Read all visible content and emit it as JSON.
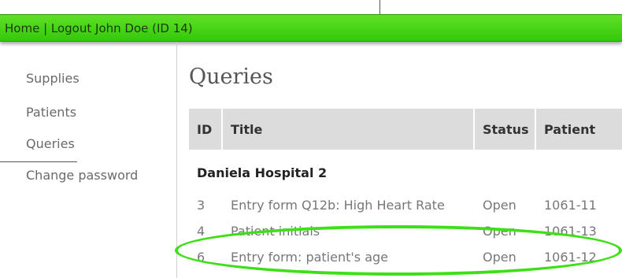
{
  "topbar": {
    "home_label": "Home",
    "separator": " | ",
    "logout_label": "Logout John Doe (ID 14)",
    "color": "#3fd414"
  },
  "sidebar": {
    "items": [
      {
        "label": "Supplies"
      },
      {
        "label": "Patients"
      },
      {
        "label": "Queries"
      },
      {
        "label": "Change password"
      }
    ]
  },
  "main": {
    "title": "Queries",
    "table": {
      "headers": [
        "ID",
        "Title",
        "Status",
        "Patient"
      ],
      "group": "Daniela Hospital 2",
      "rows": [
        {
          "id": "3",
          "title": "Entry form Q12b: High Heart Rate",
          "status": "Open",
          "patient": "1061-11"
        },
        {
          "id": "4",
          "title": "Patient initials",
          "status": "Open",
          "patient": "1061-13"
        },
        {
          "id": "6",
          "title": "Entry form: patient's age",
          "status": "Open",
          "patient": "1061-12"
        }
      ]
    }
  },
  "annotation": {
    "color": "#3de016"
  }
}
